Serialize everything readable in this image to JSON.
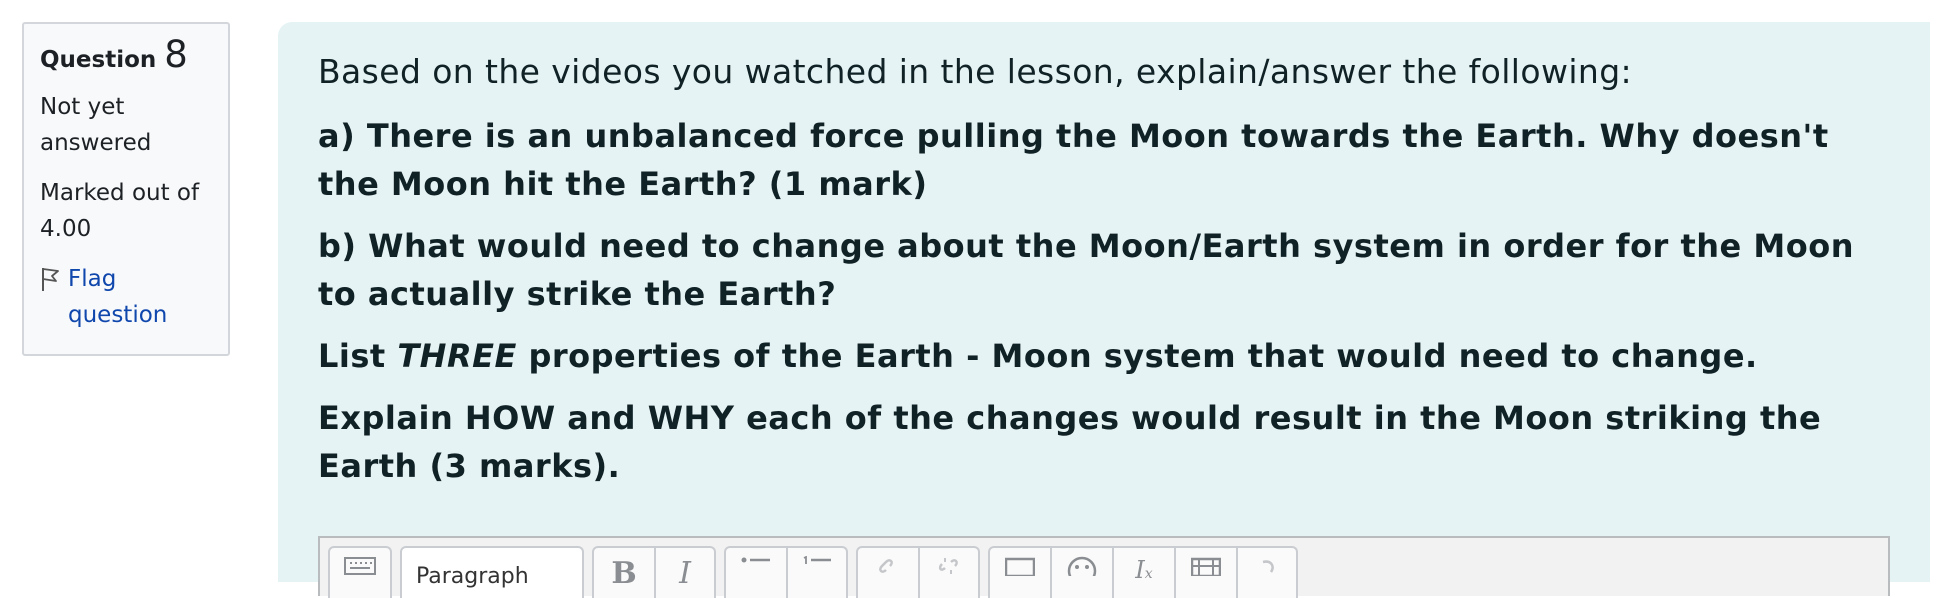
{
  "info": {
    "question_label": "Question",
    "question_number": "8",
    "state": "Not yet answered",
    "grade": "Marked out of 4.00",
    "flag_label": "Flag question"
  },
  "question": {
    "intro": "Based on the videos you watched in the lesson, explain/answer the following:",
    "part_a": "a)  There is an unbalanced force pulling the Moon towards the Earth.  Why doesn't the Moon hit the Earth?  (1 mark)",
    "part_b": "b)  What would need to change about the Moon/Earth system in order for the Moon to actually strike the Earth?",
    "list_prefix": "List ",
    "list_emphasis": "THREE",
    "list_suffix": " properties of the Earth - Moon system that would need to change.",
    "explain": "Explain HOW and WHY each of the changes would result in the Moon striking the Earth (3 marks)."
  },
  "editor": {
    "paragraph_select": "Paragraph",
    "buttons": [
      "toolbar-toggle",
      "bold",
      "italic",
      "unordered-list",
      "ordered-list",
      "link",
      "unlink",
      "image",
      "emoji",
      "clear-formatting",
      "media",
      "undo"
    ]
  }
}
